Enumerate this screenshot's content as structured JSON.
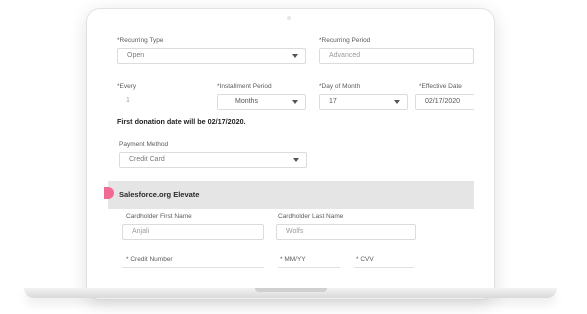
{
  "form": {
    "recurring_type": {
      "label": "*Recurring Type",
      "value": "Open"
    },
    "recurring_period": {
      "label": "*Recurring Period",
      "value": "Advanced"
    },
    "every": {
      "label": "*Every",
      "value": "1"
    },
    "installment_period": {
      "label": "*Installment Period",
      "value": "Months"
    },
    "day_of_month": {
      "label": "*Day of Month",
      "value": "17"
    },
    "effective_date": {
      "label": "*Effective Date",
      "value": "02/17/2020"
    },
    "first_donation_message": "First donation date will be 02/17/2020.",
    "payment_method": {
      "label": "Payment Method",
      "value": "Credit Card"
    }
  },
  "section": {
    "title": "Salesforce.org Elevate",
    "cardholder_first": {
      "label": "Cardholder First Name",
      "value": "Anjali"
    },
    "cardholder_last": {
      "label": "Cardholder Last Name",
      "value": "Wolfs"
    },
    "credit_number": {
      "label": "* Credit Number"
    },
    "mmyy": {
      "label": "* MM/YY"
    },
    "cvv": {
      "label": "* CVV"
    }
  },
  "colors": {
    "accent_marker": "#f06a93",
    "section_bg": "#e5e5e5"
  }
}
